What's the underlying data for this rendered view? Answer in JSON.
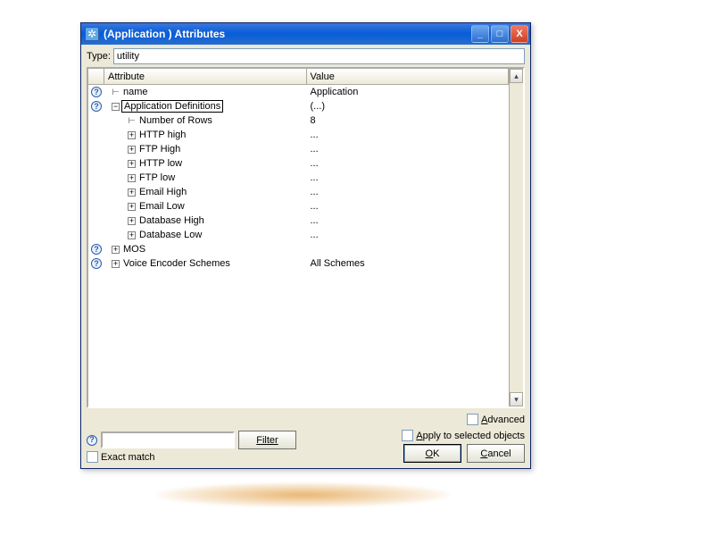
{
  "window": {
    "title": "(Application ) Attributes"
  },
  "type_row": {
    "label": "Type:",
    "value": "utility"
  },
  "grid": {
    "headers": {
      "attr": "Attribute",
      "val": "Value"
    },
    "rows": [
      {
        "help": true,
        "indent": 0,
        "toggle": "tick",
        "label": "name",
        "value": "Application",
        "selected": false
      },
      {
        "help": true,
        "indent": 0,
        "toggle": "minus",
        "label": "Application Definitions",
        "value": "(...)",
        "selected": true
      },
      {
        "help": false,
        "indent": 1,
        "toggle": "tick",
        "label": "Number of Rows",
        "value": "8",
        "selected": false
      },
      {
        "help": false,
        "indent": 1,
        "toggle": "plus",
        "label": "HTTP high",
        "value": "...",
        "selected": false
      },
      {
        "help": false,
        "indent": 1,
        "toggle": "plus",
        "label": "FTP High",
        "value": "...",
        "selected": false
      },
      {
        "help": false,
        "indent": 1,
        "toggle": "plus",
        "label": "HTTP low",
        "value": "...",
        "selected": false
      },
      {
        "help": false,
        "indent": 1,
        "toggle": "plus",
        "label": "FTP low",
        "value": "...",
        "selected": false
      },
      {
        "help": false,
        "indent": 1,
        "toggle": "plus",
        "label": "Email High",
        "value": "...",
        "selected": false
      },
      {
        "help": false,
        "indent": 1,
        "toggle": "plus",
        "label": "Email Low",
        "value": "...",
        "selected": false
      },
      {
        "help": false,
        "indent": 1,
        "toggle": "plus",
        "label": "Database High",
        "value": "...",
        "selected": false
      },
      {
        "help": false,
        "indent": 1,
        "toggle": "plus",
        "label": "Database Low",
        "value": "...",
        "selected": false
      },
      {
        "help": true,
        "indent": 0,
        "toggle": "plus",
        "label": "MOS",
        "value": "",
        "selected": false
      },
      {
        "help": true,
        "indent": 0,
        "toggle": "plus",
        "label": "Voice Encoder Schemes",
        "value": "All Schemes",
        "selected": false
      }
    ]
  },
  "bottom": {
    "filter_button": "Filter",
    "exact_match": "Exact match",
    "advanced": "Advanced",
    "apply_selected": "Apply to selected objects",
    "ok": "OK",
    "cancel": "Cancel"
  },
  "glyphs": {
    "help": "?",
    "plus": "+",
    "minus": "−",
    "tick": "⊦",
    "up": "▴",
    "down": "▾",
    "min": "_",
    "max": "□",
    "close": "X",
    "appicon": "✲"
  }
}
